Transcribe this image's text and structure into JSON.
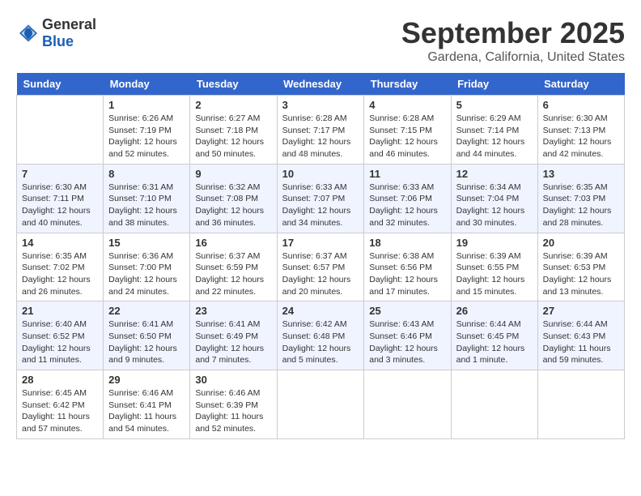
{
  "logo": {
    "general": "General",
    "blue": "Blue"
  },
  "title": "September 2025",
  "location": "Gardena, California, United States",
  "days": [
    "Sunday",
    "Monday",
    "Tuesday",
    "Wednesday",
    "Thursday",
    "Friday",
    "Saturday"
  ],
  "weeks": [
    [
      {
        "date": "",
        "content": ""
      },
      {
        "date": "1",
        "content": "Sunrise: 6:26 AM\nSunset: 7:19 PM\nDaylight: 12 hours\nand 52 minutes."
      },
      {
        "date": "2",
        "content": "Sunrise: 6:27 AM\nSunset: 7:18 PM\nDaylight: 12 hours\nand 50 minutes."
      },
      {
        "date": "3",
        "content": "Sunrise: 6:28 AM\nSunset: 7:17 PM\nDaylight: 12 hours\nand 48 minutes."
      },
      {
        "date": "4",
        "content": "Sunrise: 6:28 AM\nSunset: 7:15 PM\nDaylight: 12 hours\nand 46 minutes."
      },
      {
        "date": "5",
        "content": "Sunrise: 6:29 AM\nSunset: 7:14 PM\nDaylight: 12 hours\nand 44 minutes."
      },
      {
        "date": "6",
        "content": "Sunrise: 6:30 AM\nSunset: 7:13 PM\nDaylight: 12 hours\nand 42 minutes."
      }
    ],
    [
      {
        "date": "7",
        "content": "Sunrise: 6:30 AM\nSunset: 7:11 PM\nDaylight: 12 hours\nand 40 minutes."
      },
      {
        "date": "8",
        "content": "Sunrise: 6:31 AM\nSunset: 7:10 PM\nDaylight: 12 hours\nand 38 minutes."
      },
      {
        "date": "9",
        "content": "Sunrise: 6:32 AM\nSunset: 7:08 PM\nDaylight: 12 hours\nand 36 minutes."
      },
      {
        "date": "10",
        "content": "Sunrise: 6:33 AM\nSunset: 7:07 PM\nDaylight: 12 hours\nand 34 minutes."
      },
      {
        "date": "11",
        "content": "Sunrise: 6:33 AM\nSunset: 7:06 PM\nDaylight: 12 hours\nand 32 minutes."
      },
      {
        "date": "12",
        "content": "Sunrise: 6:34 AM\nSunset: 7:04 PM\nDaylight: 12 hours\nand 30 minutes."
      },
      {
        "date": "13",
        "content": "Sunrise: 6:35 AM\nSunset: 7:03 PM\nDaylight: 12 hours\nand 28 minutes."
      }
    ],
    [
      {
        "date": "14",
        "content": "Sunrise: 6:35 AM\nSunset: 7:02 PM\nDaylight: 12 hours\nand 26 minutes."
      },
      {
        "date": "15",
        "content": "Sunrise: 6:36 AM\nSunset: 7:00 PM\nDaylight: 12 hours\nand 24 minutes."
      },
      {
        "date": "16",
        "content": "Sunrise: 6:37 AM\nSunset: 6:59 PM\nDaylight: 12 hours\nand 22 minutes."
      },
      {
        "date": "17",
        "content": "Sunrise: 6:37 AM\nSunset: 6:57 PM\nDaylight: 12 hours\nand 20 minutes."
      },
      {
        "date": "18",
        "content": "Sunrise: 6:38 AM\nSunset: 6:56 PM\nDaylight: 12 hours\nand 17 minutes."
      },
      {
        "date": "19",
        "content": "Sunrise: 6:39 AM\nSunset: 6:55 PM\nDaylight: 12 hours\nand 15 minutes."
      },
      {
        "date": "20",
        "content": "Sunrise: 6:39 AM\nSunset: 6:53 PM\nDaylight: 12 hours\nand 13 minutes."
      }
    ],
    [
      {
        "date": "21",
        "content": "Sunrise: 6:40 AM\nSunset: 6:52 PM\nDaylight: 12 hours\nand 11 minutes."
      },
      {
        "date": "22",
        "content": "Sunrise: 6:41 AM\nSunset: 6:50 PM\nDaylight: 12 hours\nand 9 minutes."
      },
      {
        "date": "23",
        "content": "Sunrise: 6:41 AM\nSunset: 6:49 PM\nDaylight: 12 hours\nand 7 minutes."
      },
      {
        "date": "24",
        "content": "Sunrise: 6:42 AM\nSunset: 6:48 PM\nDaylight: 12 hours\nand 5 minutes."
      },
      {
        "date": "25",
        "content": "Sunrise: 6:43 AM\nSunset: 6:46 PM\nDaylight: 12 hours\nand 3 minutes."
      },
      {
        "date": "26",
        "content": "Sunrise: 6:44 AM\nSunset: 6:45 PM\nDaylight: 12 hours\nand 1 minute."
      },
      {
        "date": "27",
        "content": "Sunrise: 6:44 AM\nSunset: 6:43 PM\nDaylight: 11 hours\nand 59 minutes."
      }
    ],
    [
      {
        "date": "28",
        "content": "Sunrise: 6:45 AM\nSunset: 6:42 PM\nDaylight: 11 hours\nand 57 minutes."
      },
      {
        "date": "29",
        "content": "Sunrise: 6:46 AM\nSunset: 6:41 PM\nDaylight: 11 hours\nand 54 minutes."
      },
      {
        "date": "30",
        "content": "Sunrise: 6:46 AM\nSunset: 6:39 PM\nDaylight: 11 hours\nand 52 minutes."
      },
      {
        "date": "",
        "content": ""
      },
      {
        "date": "",
        "content": ""
      },
      {
        "date": "",
        "content": ""
      },
      {
        "date": "",
        "content": ""
      }
    ]
  ]
}
